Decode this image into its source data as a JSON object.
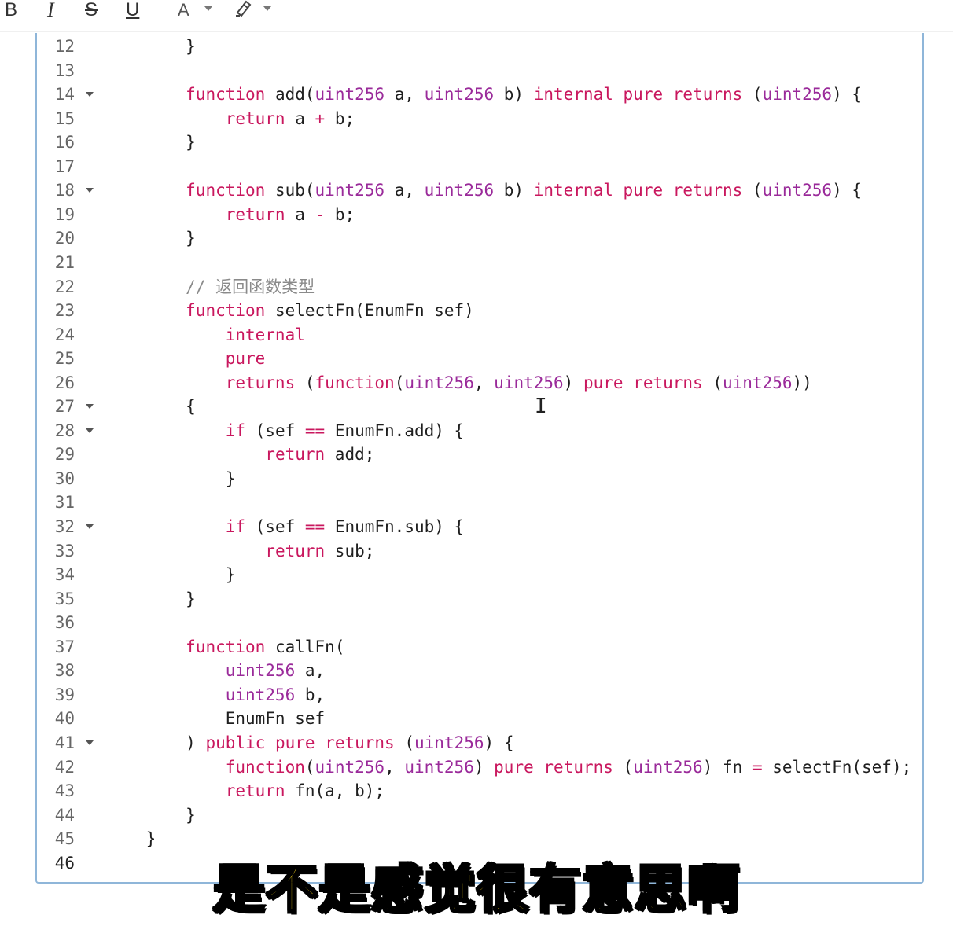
{
  "toolbar": {
    "bold_label": "B",
    "italic_label": "I",
    "strike_label": "S",
    "underline_label": "U",
    "font_color_label": "A"
  },
  "colors": {
    "keyword": "#c9175e",
    "type": "#9a2a9a",
    "comment": "#8a8a8a",
    "border": "#8fb6d9",
    "subtitle": "#f7d51a"
  },
  "editor": {
    "lines": [
      {
        "n": "12",
        "fold": false,
        "tokens": [
          [
            "        ",
            ""
          ],
          [
            "}",
            ""
          ]
        ]
      },
      {
        "n": "13",
        "fold": false,
        "tokens": []
      },
      {
        "n": "14",
        "fold": true,
        "tokens": [
          [
            "        ",
            ""
          ],
          [
            "function",
            "kw"
          ],
          [
            " add(",
            ""
          ],
          [
            "uint256",
            "ty"
          ],
          [
            " a, ",
            ""
          ],
          [
            "uint256",
            "ty"
          ],
          [
            " b) ",
            ""
          ],
          [
            "internal",
            "kw"
          ],
          [
            " ",
            ""
          ],
          [
            "pure",
            "kw"
          ],
          [
            " ",
            ""
          ],
          [
            "returns",
            "kw"
          ],
          [
            " (",
            ""
          ],
          [
            "uint256",
            "ty"
          ],
          [
            ") {",
            ""
          ]
        ]
      },
      {
        "n": "15",
        "fold": false,
        "tokens": [
          [
            "            ",
            ""
          ],
          [
            "return",
            "kw"
          ],
          [
            " a ",
            ""
          ],
          [
            "+",
            "op"
          ],
          [
            " b;",
            ""
          ]
        ]
      },
      {
        "n": "16",
        "fold": false,
        "tokens": [
          [
            "        ",
            ""
          ],
          [
            "}",
            ""
          ]
        ]
      },
      {
        "n": "17",
        "fold": false,
        "tokens": []
      },
      {
        "n": "18",
        "fold": true,
        "tokens": [
          [
            "        ",
            ""
          ],
          [
            "function",
            "kw"
          ],
          [
            " sub(",
            ""
          ],
          [
            "uint256",
            "ty"
          ],
          [
            " a, ",
            ""
          ],
          [
            "uint256",
            "ty"
          ],
          [
            " b) ",
            ""
          ],
          [
            "internal",
            "kw"
          ],
          [
            " ",
            ""
          ],
          [
            "pure",
            "kw"
          ],
          [
            " ",
            ""
          ],
          [
            "returns",
            "kw"
          ],
          [
            " (",
            ""
          ],
          [
            "uint256",
            "ty"
          ],
          [
            ") {",
            ""
          ]
        ]
      },
      {
        "n": "19",
        "fold": false,
        "tokens": [
          [
            "            ",
            ""
          ],
          [
            "return",
            "kw"
          ],
          [
            " a ",
            ""
          ],
          [
            "-",
            "op"
          ],
          [
            " b;",
            ""
          ]
        ]
      },
      {
        "n": "20",
        "fold": false,
        "tokens": [
          [
            "        ",
            ""
          ],
          [
            "}",
            ""
          ]
        ]
      },
      {
        "n": "21",
        "fold": false,
        "tokens": []
      },
      {
        "n": "22",
        "fold": false,
        "tokens": [
          [
            "        ",
            ""
          ],
          [
            "// 返回函数类型",
            "cm"
          ]
        ]
      },
      {
        "n": "23",
        "fold": false,
        "tokens": [
          [
            "        ",
            ""
          ],
          [
            "function",
            "kw"
          ],
          [
            " selectFn(EnumFn sef)",
            ""
          ]
        ]
      },
      {
        "n": "24",
        "fold": false,
        "tokens": [
          [
            "            ",
            ""
          ],
          [
            "internal",
            "kw"
          ]
        ]
      },
      {
        "n": "25",
        "fold": false,
        "tokens": [
          [
            "            ",
            ""
          ],
          [
            "pure",
            "kw"
          ]
        ]
      },
      {
        "n": "26",
        "fold": false,
        "tokens": [
          [
            "            ",
            ""
          ],
          [
            "returns",
            "kw"
          ],
          [
            " (",
            ""
          ],
          [
            "function",
            "kw"
          ],
          [
            "(",
            ""
          ],
          [
            "uint256",
            "ty"
          ],
          [
            ", ",
            ""
          ],
          [
            "uint256",
            "ty"
          ],
          [
            ") ",
            ""
          ],
          [
            "pure",
            "kw"
          ],
          [
            " ",
            ""
          ],
          [
            "returns",
            "kw"
          ],
          [
            " (",
            ""
          ],
          [
            "uint256",
            "ty"
          ],
          [
            "))",
            ""
          ]
        ]
      },
      {
        "n": "27",
        "fold": true,
        "tokens": [
          [
            "        ",
            ""
          ],
          [
            "{",
            ""
          ]
        ]
      },
      {
        "n": "28",
        "fold": true,
        "tokens": [
          [
            "            ",
            ""
          ],
          [
            "if",
            "kw"
          ],
          [
            " (sef ",
            ""
          ],
          [
            "==",
            "op"
          ],
          [
            " EnumFn.add) {",
            ""
          ]
        ]
      },
      {
        "n": "29",
        "fold": false,
        "tokens": [
          [
            "                ",
            ""
          ],
          [
            "return",
            "kw"
          ],
          [
            " add;",
            ""
          ]
        ]
      },
      {
        "n": "30",
        "fold": false,
        "tokens": [
          [
            "            ",
            ""
          ],
          [
            "}",
            ""
          ]
        ]
      },
      {
        "n": "31",
        "fold": false,
        "tokens": []
      },
      {
        "n": "32",
        "fold": true,
        "tokens": [
          [
            "            ",
            ""
          ],
          [
            "if",
            "kw"
          ],
          [
            " (sef ",
            ""
          ],
          [
            "==",
            "op"
          ],
          [
            " EnumFn.sub) {",
            ""
          ]
        ]
      },
      {
        "n": "33",
        "fold": false,
        "tokens": [
          [
            "                ",
            ""
          ],
          [
            "return",
            "kw"
          ],
          [
            " sub;",
            ""
          ]
        ]
      },
      {
        "n": "34",
        "fold": false,
        "tokens": [
          [
            "            ",
            ""
          ],
          [
            "}",
            ""
          ]
        ]
      },
      {
        "n": "35",
        "fold": false,
        "tokens": [
          [
            "        ",
            ""
          ],
          [
            "}",
            ""
          ]
        ]
      },
      {
        "n": "36",
        "fold": false,
        "tokens": []
      },
      {
        "n": "37",
        "fold": false,
        "tokens": [
          [
            "        ",
            ""
          ],
          [
            "function",
            "kw"
          ],
          [
            " callFn(",
            ""
          ]
        ]
      },
      {
        "n": "38",
        "fold": false,
        "tokens": [
          [
            "            ",
            ""
          ],
          [
            "uint256",
            "ty"
          ],
          [
            " a,",
            ""
          ]
        ]
      },
      {
        "n": "39",
        "fold": false,
        "tokens": [
          [
            "            ",
            ""
          ],
          [
            "uint256",
            "ty"
          ],
          [
            " b,",
            ""
          ]
        ]
      },
      {
        "n": "40",
        "fold": false,
        "tokens": [
          [
            "            ",
            ""
          ],
          [
            "EnumFn sef",
            ""
          ]
        ]
      },
      {
        "n": "41",
        "fold": true,
        "tokens": [
          [
            "        ",
            ""
          ],
          [
            ") ",
            ""
          ],
          [
            "public",
            "kw"
          ],
          [
            " ",
            ""
          ],
          [
            "pure",
            "kw"
          ],
          [
            " ",
            ""
          ],
          [
            "returns",
            "kw"
          ],
          [
            " (",
            ""
          ],
          [
            "uint256",
            "ty"
          ],
          [
            ") {",
            ""
          ]
        ]
      },
      {
        "n": "42",
        "fold": false,
        "tokens": [
          [
            "            ",
            ""
          ],
          [
            "function",
            "kw"
          ],
          [
            "(",
            ""
          ],
          [
            "uint256",
            "ty"
          ],
          [
            ", ",
            ""
          ],
          [
            "uint256",
            "ty"
          ],
          [
            ") ",
            ""
          ],
          [
            "pure",
            "kw"
          ],
          [
            " ",
            ""
          ],
          [
            "returns",
            "kw"
          ],
          [
            " (",
            ""
          ],
          [
            "uint256",
            "ty"
          ],
          [
            ") fn ",
            ""
          ],
          [
            "=",
            "op"
          ],
          [
            " selectFn(sef);",
            ""
          ]
        ]
      },
      {
        "n": "43",
        "fold": false,
        "tokens": [
          [
            "            ",
            ""
          ],
          [
            "return",
            "kw"
          ],
          [
            " fn(a, b);",
            ""
          ]
        ]
      },
      {
        "n": "44",
        "fold": false,
        "tokens": [
          [
            "        ",
            ""
          ],
          [
            "}",
            ""
          ]
        ]
      },
      {
        "n": "45",
        "fold": false,
        "tokens": [
          [
            "    ",
            ""
          ],
          [
            "}",
            ""
          ]
        ]
      },
      {
        "n": "46",
        "fold": false,
        "tokens": []
      }
    ]
  },
  "subtitle": "是不是感觉很有意思啊"
}
